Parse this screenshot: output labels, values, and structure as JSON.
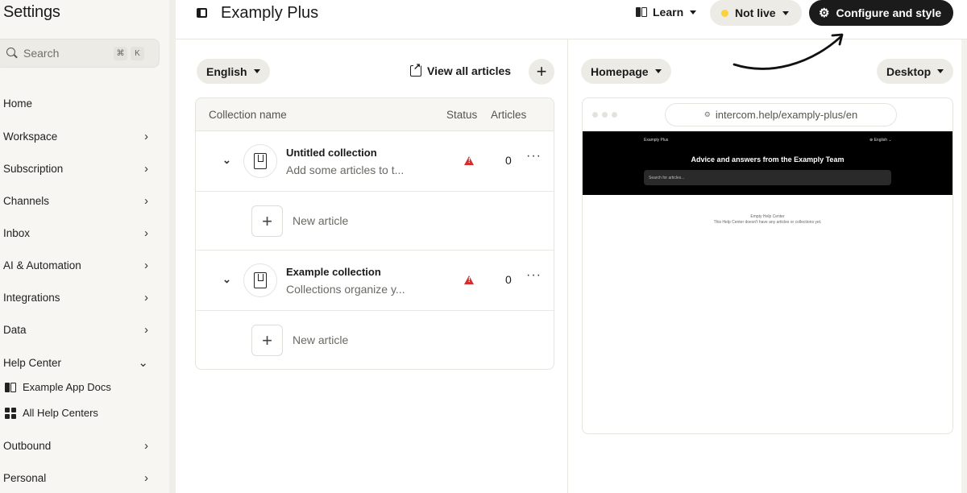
{
  "sidebar": {
    "title": "Settings",
    "search": {
      "placeholder": "Search",
      "shortcut_mod": "⌘",
      "shortcut_key": "K"
    },
    "items": [
      {
        "label": "Home"
      },
      {
        "label": "Workspace",
        "chevron": "›"
      },
      {
        "label": "Subscription",
        "chevron": "›"
      },
      {
        "label": "Channels",
        "chevron": "›"
      },
      {
        "label": "Inbox",
        "chevron": "›"
      },
      {
        "label": "AI & Automation",
        "chevron": "›"
      },
      {
        "label": "Integrations",
        "chevron": "›"
      },
      {
        "label": "Data",
        "chevron": "›"
      },
      {
        "label": "Help Center",
        "chevron": "⌄"
      },
      {
        "label": "Outbound",
        "chevron": "›"
      },
      {
        "label": "Personal",
        "chevron": "›"
      }
    ],
    "help_center_subitems": [
      {
        "label": "Example App Docs",
        "icon": "book-icon"
      },
      {
        "label": "All Help Centers",
        "icon": "grid-icon"
      }
    ]
  },
  "header": {
    "title": "Examply Plus",
    "learn_label": "Learn",
    "status_label": "Not live",
    "configure_label": "Configure and style"
  },
  "toolbar": {
    "language": "English",
    "view_all_label": "View all articles",
    "add_label": "+"
  },
  "table": {
    "columns": [
      "Collection name",
      "Status",
      "Articles"
    ],
    "collections": [
      {
        "name": "Untitled collection",
        "description": "Add some articles to t...",
        "articles": "0"
      },
      {
        "name": "Example collection",
        "description": "Collections organize y...",
        "articles": "0"
      }
    ],
    "new_article_label": "New article",
    "more_label": "···"
  },
  "preview": {
    "page_select": "Homepage",
    "device_select": "Desktop",
    "url": "intercom.help/examply-plus/en",
    "hc_brand": "Examply Plus",
    "hc_lang": "⊕ English ⌄",
    "hc_title": "Advice and answers from the Examply Team",
    "hc_search_placeholder": "Search for articles...",
    "hc_empty_title": "Empty Help Center",
    "hc_empty_text": "This Help Center doesn't have any articles or collections yet."
  },
  "colors": {
    "sidebar_bg": "#f7f6f3",
    "pill_bg": "#ecebe6",
    "dark_button": "#1b1b1b",
    "status_dot": "#f9d23c",
    "warning": "#d32f2f"
  }
}
